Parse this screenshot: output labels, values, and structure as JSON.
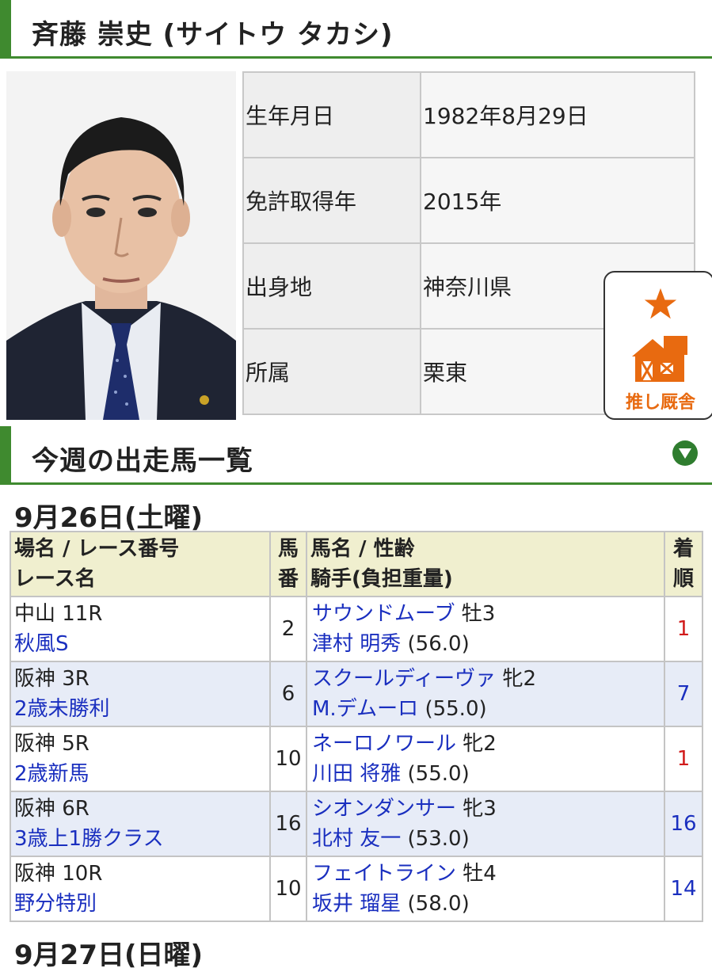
{
  "profile": {
    "name": "斉藤 崇史 (サイトウ タカシ)",
    "rows": [
      {
        "key": "生年月日",
        "value": "1982年8月29日"
      },
      {
        "key": "免許取得年",
        "value": "2015年"
      },
      {
        "key": "出身地",
        "value": "神奈川県"
      },
      {
        "key": "所属",
        "value": "栗東"
      }
    ]
  },
  "favorite": {
    "label": "推し厩舎",
    "accent": "#e86a10"
  },
  "entries": {
    "title": "今週の出走馬一覧",
    "date": "9月26日(土曜)",
    "headers": {
      "course_line1": "場名 / レース番号",
      "course_line2": "レース名",
      "num_line1": "馬",
      "num_line2": "番",
      "horse_line1": "馬名 / 性齢",
      "horse_line2": "騎手(負担重量)",
      "rank_line1": "着",
      "rank_line2": "順"
    },
    "rows": [
      {
        "course": "中山 11R",
        "race": "秋風S",
        "num": "2",
        "horse": "サウンドムーブ",
        "sexage": "牡3",
        "jockey": "津村 明秀",
        "weight": "(56.0)",
        "rank": "1"
      },
      {
        "course": "阪神 3R",
        "race": "2歳未勝利",
        "num": "6",
        "horse": "スクールディーヴァ",
        "sexage": "牝2",
        "jockey": "M.デムーロ",
        "weight": "(55.0)",
        "rank": "7"
      },
      {
        "course": "阪神 5R",
        "race": "2歳新馬",
        "num": "10",
        "horse": "ネーロノワール",
        "sexage": "牝2",
        "jockey": "川田 将雅",
        "weight": "(55.0)",
        "rank": "1"
      },
      {
        "course": "阪神 6R",
        "race": "3歳上1勝クラス",
        "num": "16",
        "horse": "シオンダンサー",
        "sexage": "牝3",
        "jockey": "北村 友一",
        "weight": "(53.0)",
        "rank": "16"
      },
      {
        "course": "阪神 10R",
        "race": "野分特別",
        "num": "10",
        "horse": "フェイトライン",
        "sexage": "牡4",
        "jockey": "坂井 瑠星",
        "weight": "(58.0)",
        "rank": "14"
      }
    ],
    "next_date": "9月27日(日曜)"
  },
  "colors": {
    "green": "#3f8a2f",
    "link": "#1a2fbf",
    "win": "#d11a1a",
    "header_bg": "#f0efcf",
    "alt_row": "#e7ecf7"
  }
}
